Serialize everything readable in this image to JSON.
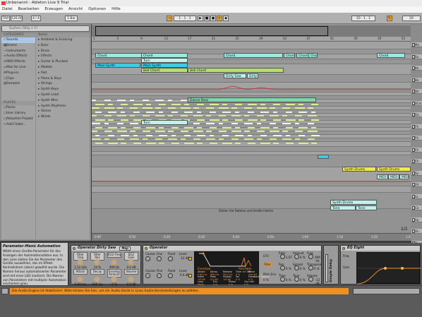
{
  "window": {
    "title": "Unbenannt - Ableton Live 9 Trial"
  },
  "menu": [
    "Datei",
    "Bearbeiten",
    "Erzeugen",
    "Ansicht",
    "Optionen",
    "Hilfe"
  ],
  "transport": {
    "tap": "TAP",
    "tempo": "120.00",
    "signature": "4 / 4",
    "quantize": "1 Bar",
    "position": "1 . 1 . 1",
    "loop_start": "1 . 1 . 1",
    "loop_length": "20 . 1 . 1",
    "right_value": "20"
  },
  "browser": {
    "search_placeholder": "Suchen (Strg + F)",
    "categories_header": "CATEGORIES",
    "categories": [
      {
        "icon": "♪",
        "label": "Sounds",
        "selected": true
      },
      {
        "icon": "▦",
        "label": "Drums"
      },
      {
        "icon": "~",
        "label": "Instruments"
      },
      {
        "icon": "≈",
        "label": "Audio Effects"
      },
      {
        "icon": "≋",
        "label": "MIDI Effects"
      },
      {
        "icon": "▭",
        "label": "Max for Live"
      },
      {
        "icon": "⚙",
        "label": "Plug-ins"
      },
      {
        "icon": "▢",
        "label": "Clips"
      },
      {
        "icon": "▥",
        "label": "Samples"
      }
    ],
    "places_header": "PLACES",
    "places": [
      {
        "icon": "▢",
        "label": "Packs"
      },
      {
        "icon": "▢",
        "label": "User Library"
      },
      {
        "icon": "▢",
        "label": "Aktuelles Projekt"
      },
      {
        "icon": "+",
        "label": "Add Folder..."
      }
    ],
    "names_header": "Name",
    "names": [
      "Ambient & Evolving",
      "Bass",
      "Brass",
      "Effects",
      "Guitar & Plucked",
      "Mallets",
      "Pad",
      "Piano & Keys",
      "Strings",
      "Synth Keys",
      "Synth Lead",
      "Synth Misc",
      "Synth Rhythmic",
      "Voices",
      "Winds"
    ]
  },
  "arrangement": {
    "ruler": [
      "1",
      "5",
      "9",
      "13",
      "17",
      "21",
      "25",
      "29",
      "33",
      "37",
      "41",
      "45",
      "49",
      "53"
    ],
    "clips": [
      {
        "label": "Chord",
        "color": "cyan"
      },
      {
        "label": "Chord",
        "color": "cyan"
      },
      {
        "label": "Chord",
        "color": "cyan"
      },
      {
        "label": "Chord",
        "color": "cyan"
      },
      {
        "label": "Chord",
        "color": "cyan"
      },
      {
        "label": "Chord",
        "color": "cyan"
      },
      {
        "label": "Chord",
        "color": "cyan"
      },
      {
        "label": "Turn",
        "color": "lcyan"
      },
      {
        "label": "Main Synth",
        "color": "blue"
      },
      {
        "label": "Main Synth",
        "color": "blue"
      },
      {
        "label": "Bell Chord",
        "color": "green"
      },
      {
        "label": "Bell Chord",
        "color": "green"
      },
      {
        "label": "Dirty Saw",
        "color": "lcyan"
      },
      {
        "label": "Dirty",
        "color": "lcyan"
      },
      {
        "label": "Dance Bass",
        "color": "mgreen"
      },
      {
        "label": "Turn",
        "color": "lcyan"
      },
      {
        "label": "Synth Drums",
        "color": "yel"
      },
      {
        "label": "Synth Drums",
        "color": "yel"
      },
      {
        "label": "MIDI Le",
        "color": "lcyan"
      },
      {
        "label": "MIDI Le",
        "color": "lcyan"
      },
      {
        "label": "MIDI",
        "color": "lcyan"
      },
      {
        "label": "Synth Drums",
        "color": "lcyan"
      },
      {
        "label": "Tone",
        "color": "lcyan"
      },
      {
        "label": "Tone",
        "color": "lcyan"
      }
    ],
    "drop_hint": "Ziehen Sie Dateien und Geräte hierhin",
    "page_indicator": "1/1",
    "time_labels": [
      "0:00",
      "0:10",
      "0:20",
      "0:30",
      "0:40",
      "0:50",
      "1:00",
      "1:10",
      "1:20",
      "1:30"
    ]
  },
  "mixer": {
    "tracks": [
      "Ma",
      "Su",
      "Be",
      "Be",
      "Dir",
      "DCon",
      "Da",
      "FX",
      "FX",
      "FX",
      "FX",
      "Sy",
      "24",
      "Lo",
      "Ca",
      "Ap",
      "On",
      "Tr"
    ]
  },
  "info": {
    "title": "Parameter-Menü Automation",
    "text": "Wählt einen Geräte-Parameter für das Anzeigen der Automationsdaten aus. In den Lane ziehen Sie die Parameter des Geräte auswählen, das im Effekt-Kontrollstrom (oben) gewählt wurde. Die Namen heraus automatisierter Parameter sind mit einer LED markiert. Die Namen von Parametern mit multipler Automation erscheinen grau."
  },
  "devices": {
    "dirty_saw": {
      "title": "Operator Dirty Saw",
      "map_label": "Map",
      "macros": [
        {
          "label": "Filter Freq",
          "value": "1.12 kHz"
        },
        {
          "label": "Filter Res",
          "value": "34 %"
        },
        {
          "label": "EG2 Freq",
          "value": "909 Hz"
        },
        {
          "label": "EG2 Gain",
          "value": "0.0 dB"
        },
        {
          "label": "Attack",
          "value": "0.00 ms"
        },
        {
          "label": "Decay",
          "value": "600 ms"
        },
        {
          "label": "Envelop Amount",
          "value": "0 %"
        },
        {
          "label": "Volume",
          "value": "0.0 dB"
        }
      ]
    },
    "operator": {
      "title": "Operator",
      "osc_labels": [
        "Coarse",
        "Fine",
        "Fixed",
        "Level"
      ],
      "levels": [
        "-12 dB",
        "0.0 dB",
        "0.0 dB",
        "0.0 dB"
      ],
      "env_header": [
        "Envelope",
        "Oscillator"
      ],
      "env_params": [
        "Attack",
        "Decay",
        "Release",
        "Time <> Vel",
        "Wave",
        "Initial",
        "Peak",
        "Sustain",
        "Vel",
        "Feedback",
        "Repeat"
      ],
      "env_values": [
        "0.00 ms",
        "600 ms",
        "50.0 ms",
        "0 %",
        "Saw 64",
        "-inf dB",
        "0.0 dB",
        "-inf dB",
        "0 %",
        "0 %",
        "Off"
      ],
      "loop": [
        "Loop",
        "Env",
        "Phase",
        "Osc<Vel"
      ],
      "loop_values": [
        "None",
        "0 %",
        "0 %",
        "0 %"
      ],
      "right": {
        "lfo": "LFO",
        "labels": [
          "Rate",
          "Amount",
          "Freq",
          "Res",
          "Spread",
          "Transpose",
          "Time",
          "Tone",
          "Volume"
        ],
        "values": [
          "1.07",
          "0 %",
          "909 Hz",
          "0 %",
          "0 %",
          "0 st",
          "0 %",
          "0 %",
          "-12 dB"
        ],
        "filter": "Filter",
        "pitch_env": "Pitch Env",
        "env_val": "0 %"
      }
    },
    "simple_delay": {
      "title": "Simple Delay",
      "vertical_label": "Simple Delay"
    },
    "eq": {
      "title": "EQ Eight",
      "adapt_label": "Adapt Q",
      "gain_label": "Gain",
      "freq_label": "Freq"
    }
  },
  "status": {
    "message": "Die Audio-Engine ist deaktiviert. Bitte klicken Sie hier, um ein Audio-Gerät in Lives Audio-Voreinstellungen zu wählen."
  },
  "colors": {
    "accent": "#f49020",
    "clip_cyan": "#9de8e0",
    "clip_green": "#b5e06e",
    "clip_yellow": "#f4e84e",
    "clip_blue": "#3fcbe6",
    "loop_orange": "#f4a020"
  }
}
